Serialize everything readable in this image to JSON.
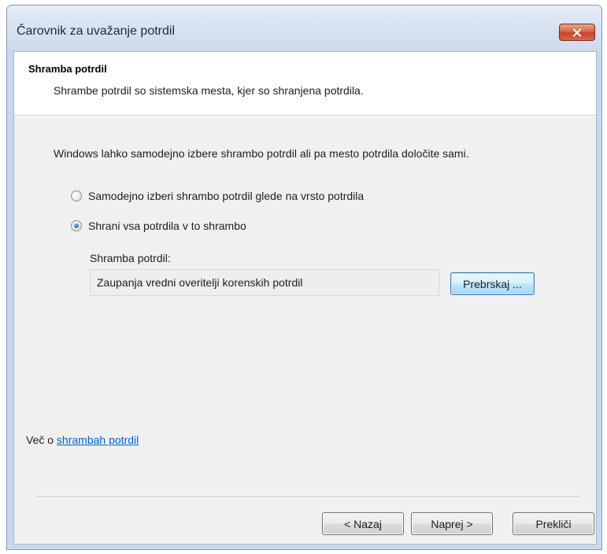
{
  "window": {
    "title": "Čarovnik za uvažanje potrdil"
  },
  "header": {
    "title": "Shramba potrdil",
    "subtitle": "Shrambe potrdil so sistemska mesta, kjer so shranjena potrdila."
  },
  "content": {
    "intro": "Windows lahko samodejno izbere shrambo potrdil ali pa mesto potrdila določite sami.",
    "options": [
      {
        "label": "Samodejno izberi shrambo potrdil glede na vrsto potrdila",
        "checked": false
      },
      {
        "label": "Shrani vsa potrdila v to shrambo",
        "checked": true
      }
    ],
    "store_label": "Shramba potrdil:",
    "store_value": "Zaupanja vredni overitelji korenskih potrdil",
    "browse_label": "Prebrskaj ..."
  },
  "footer": {
    "more_prefix": "Več o ",
    "more_link": "shrambah potrdil",
    "back_label": "< Nazaj",
    "next_label": "Naprej >",
    "cancel_label": "Prekliči"
  },
  "colors": {
    "link": "#0066cc",
    "close_button": "#c6452b",
    "titlebar": "#ccdbec"
  }
}
